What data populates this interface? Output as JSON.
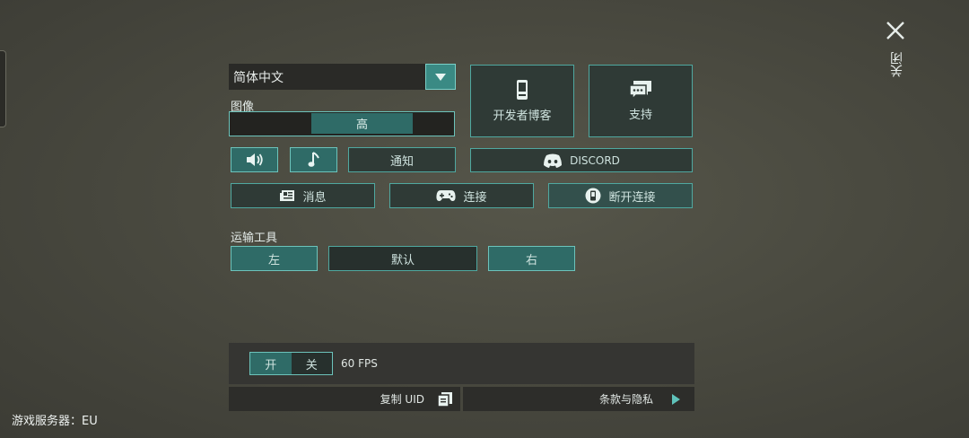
{
  "close": {
    "label": "关闭"
  },
  "language": {
    "selected": "简体中文"
  },
  "graphics": {
    "label": "图像",
    "value": "高"
  },
  "developer_blog": {
    "label": "开发者博客"
  },
  "support": {
    "label": "支持"
  },
  "notifications": {
    "label": "通知"
  },
  "discord": {
    "label": "DISCORD"
  },
  "news": {
    "label": "消息"
  },
  "connect": {
    "label": "连接"
  },
  "disconnect": {
    "label": "断开连接"
  },
  "vehicle": {
    "label": "运输工具",
    "left": "左",
    "default": "默认",
    "right": "右"
  },
  "fps": {
    "on": "开",
    "off": "关",
    "value": "60 FPS"
  },
  "copy_uid": {
    "label": "复制 UID"
  },
  "terms": {
    "label": "条款与隐私"
  },
  "server": {
    "label": "游戏服务器：EU"
  },
  "icons": {
    "sound": "speaker-icon",
    "music": "music-note-icon",
    "phone": "phone-icon",
    "chat": "chat-bubbles-icon",
    "discord": "discord-icon",
    "news": "newspaper-icon",
    "gamepad": "gamepad-icon",
    "disconnect": "phone-disconnect-icon",
    "copy": "copy-icon",
    "arrow": "play-arrow-icon",
    "dropdown": "triangle-down-icon",
    "close": "close-icon"
  },
  "colors": {
    "accent": "#4fa8a0",
    "teal_fill": "#2f6b67",
    "dark_fill": "#2f3a36"
  }
}
